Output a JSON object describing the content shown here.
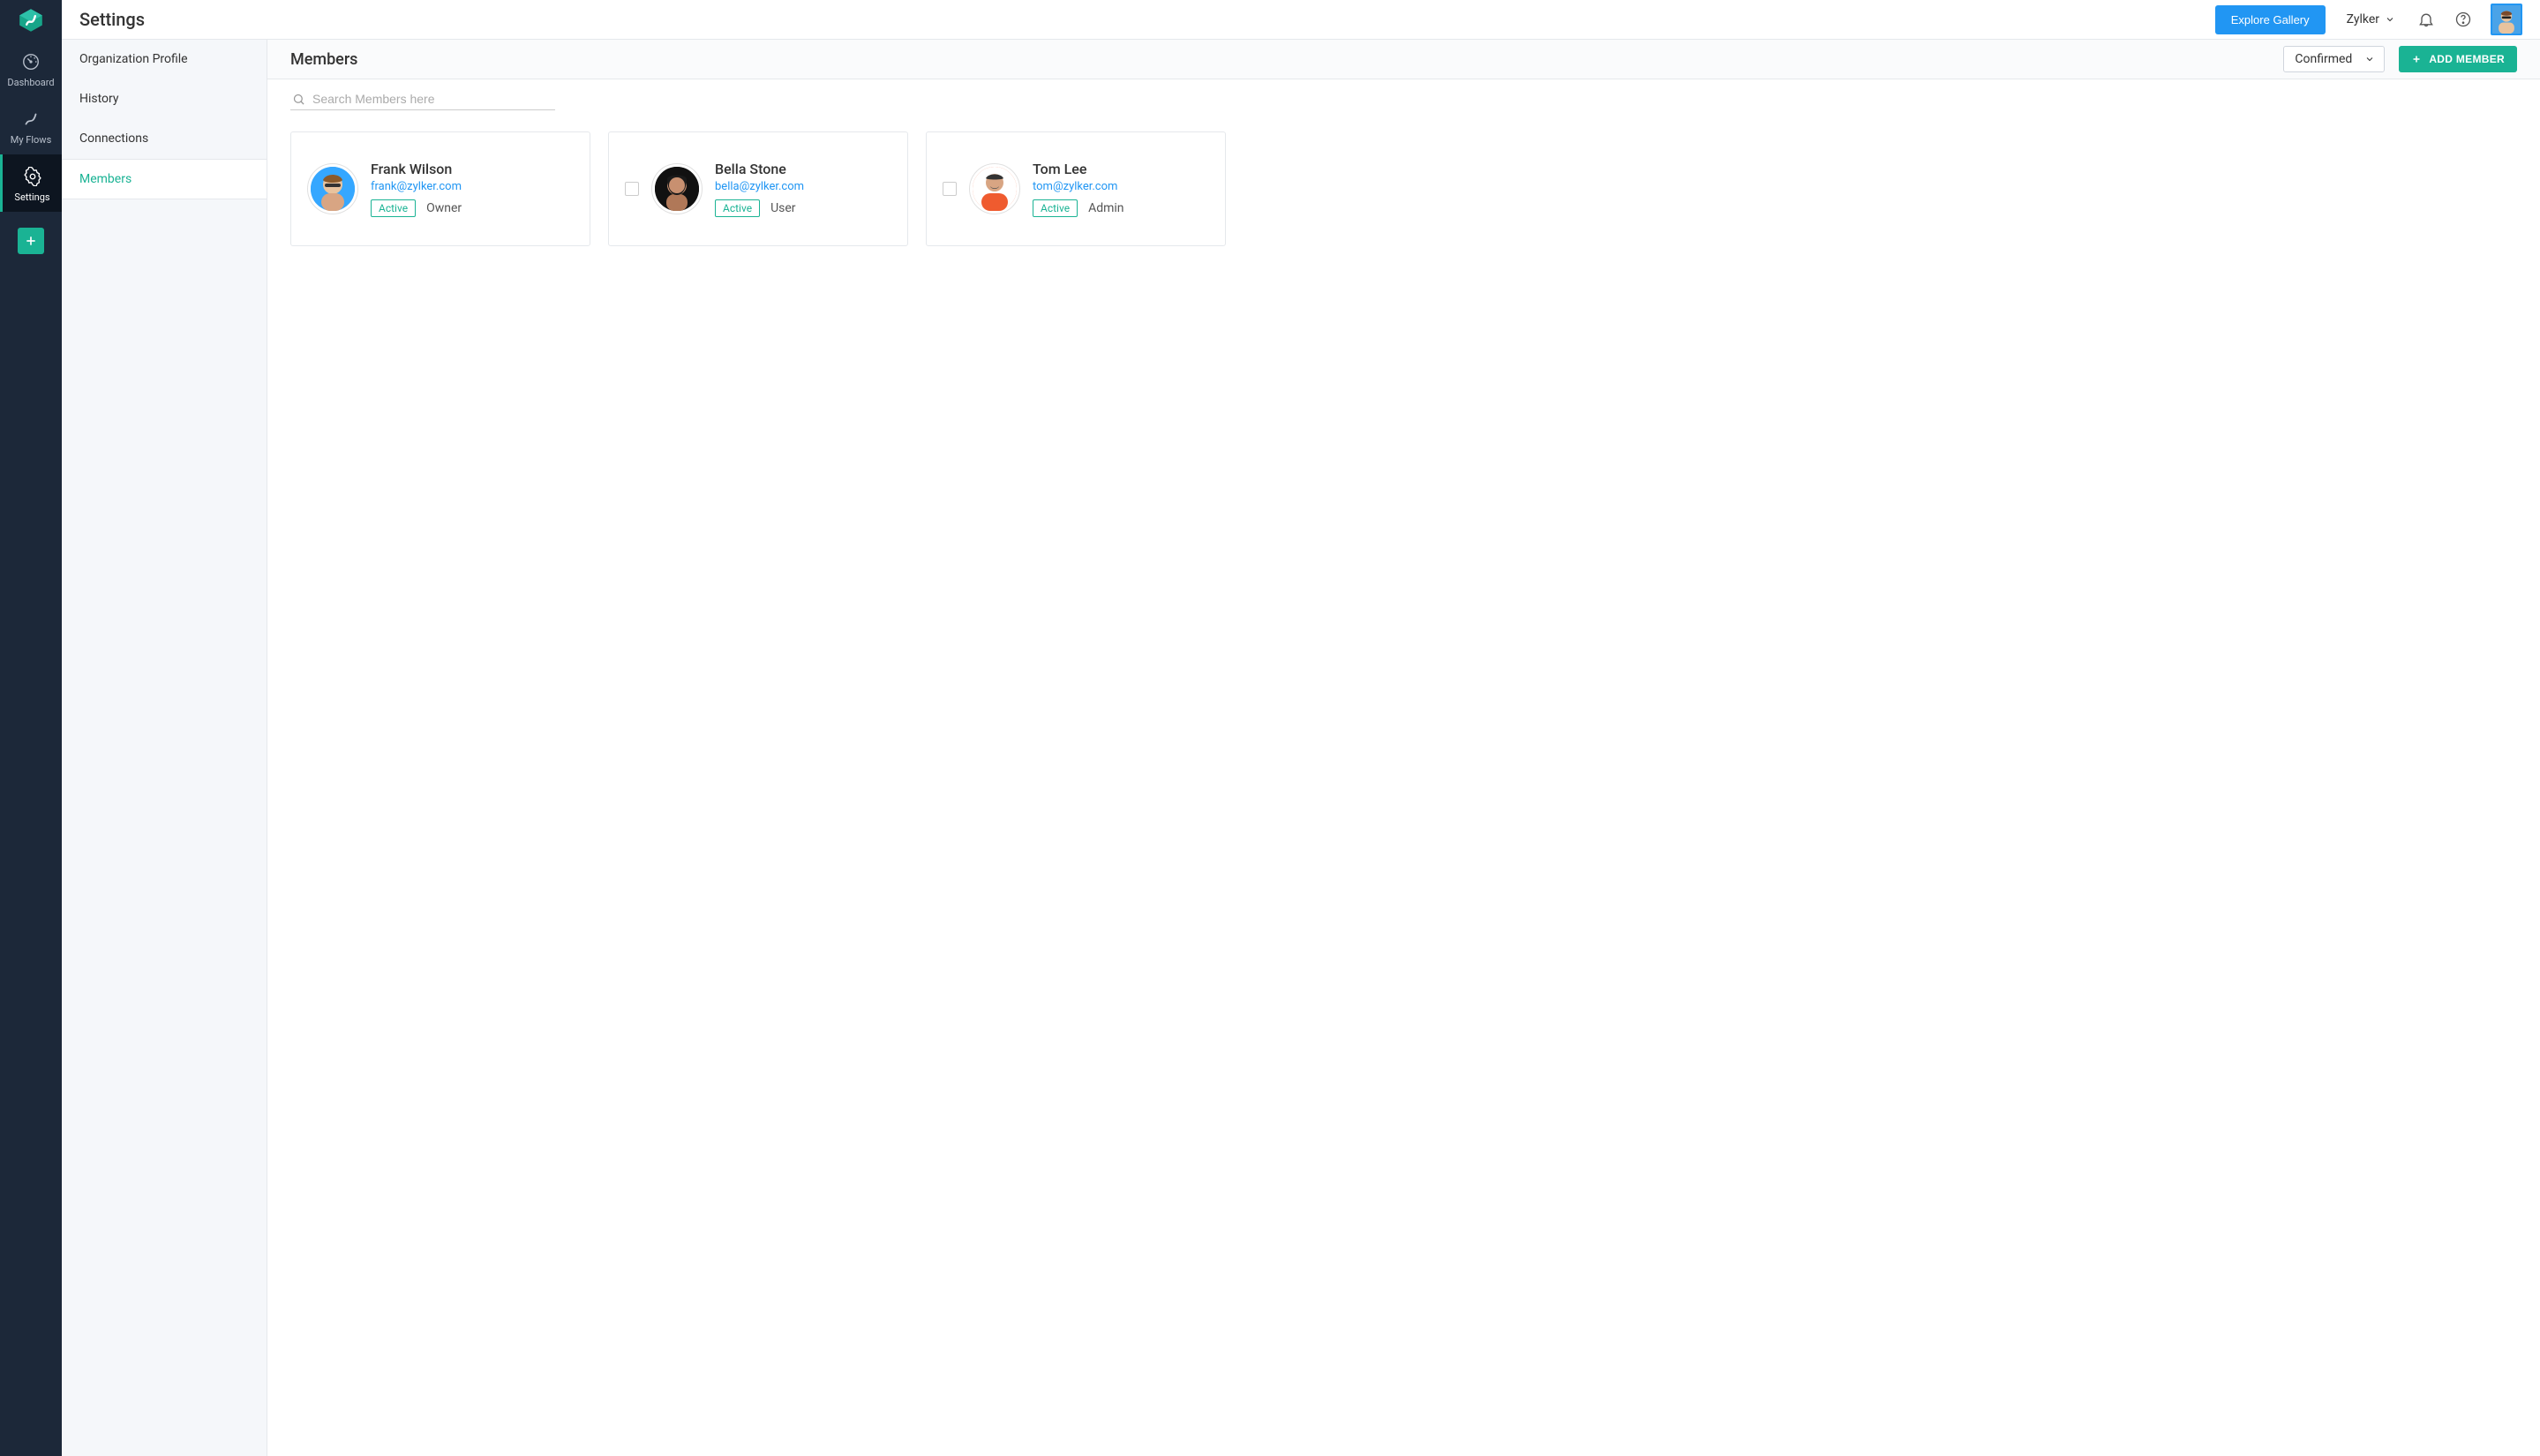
{
  "header": {
    "page_title": "Settings",
    "explore_label": "Explore Gallery",
    "org_name": "Zylker"
  },
  "nav": {
    "items": [
      {
        "label": "Dashboard"
      },
      {
        "label": "My Flows"
      },
      {
        "label": "Settings"
      }
    ]
  },
  "settings_sidebar": {
    "items": [
      {
        "label": "Organization Profile"
      },
      {
        "label": "History"
      },
      {
        "label": "Connections"
      },
      {
        "label": "Members"
      }
    ]
  },
  "members_page": {
    "title": "Members",
    "status_filter": "Confirmed",
    "add_member_label": "ADD MEMBER",
    "search_placeholder": "Search Members here",
    "members": [
      {
        "name": "Frank Wilson",
        "email": "frank@zylker.com",
        "status": "Active",
        "role": "Owner",
        "selectable": false
      },
      {
        "name": "Bella Stone",
        "email": "bella@zylker.com",
        "status": "Active",
        "role": "User",
        "selectable": true
      },
      {
        "name": "Tom Lee",
        "email": "tom@zylker.com",
        "status": "Active",
        "role": "Admin",
        "selectable": true
      }
    ]
  }
}
